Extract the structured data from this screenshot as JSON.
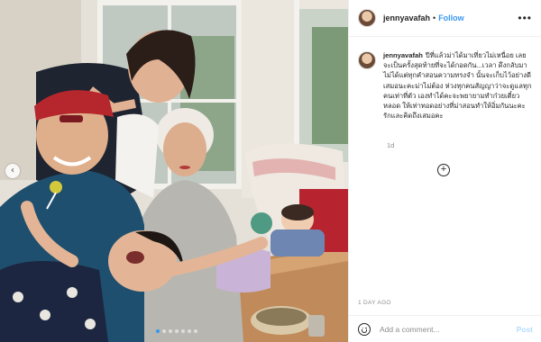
{
  "post": {
    "username": "jennyavafah",
    "separator": "•",
    "follow_label": "Follow",
    "more_icon": "more-options-icon",
    "caption": "ปีที่แล้วม่าได้มาเที่ยวไม่เหนื่อย เลยจะเป็นครั้งสุดท้ายที่จะได้กอดกัน...เวลา ดึงกลับมาไม่ได้แต่ทุกคำสอนความทรงจำ นั้นจะเก็บไว้อย่างดีเสมอนะคะม่าไม่ต้อง ห่วงทุกคนสัญญาว่าจะดูแลทุกคนเท่าที่ตัว เองทำได้คะจะพยายามทำก๋วยเตี๋ยวหลอด ให้เท่าทอดอย่างที่ม่าสอนทำให้อิ่มกันนะคะ รักและคิดถึงเสมอคะ",
    "caption_time": "1d",
    "load_more_icon": "plus-circle-icon",
    "timestamp": "1 DAY AGO",
    "comment_placeholder": "Add a comment...",
    "post_label": "Post",
    "colors": {
      "accent": "#3897f0",
      "post_disabled": "#b3dbff",
      "secondary_text": "#8e8e8e"
    }
  },
  "carousel": {
    "prev_icon": "chevron-left-icon",
    "dot_count": 7,
    "active_dot": 0
  }
}
